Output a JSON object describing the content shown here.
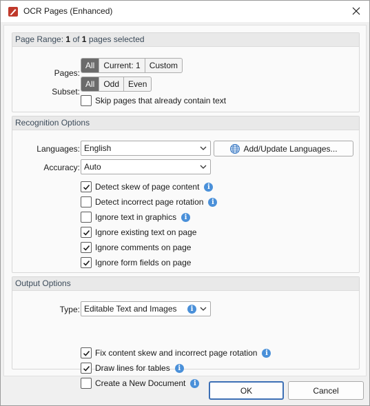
{
  "window": {
    "title": "OCR Pages (Enhanced)"
  },
  "page_range": {
    "header_prefix": "Page Range:",
    "selected_current": "1",
    "header_of": "of",
    "selected_total": "1",
    "header_suffix": "pages selected",
    "pages_label": "Pages:",
    "pages_options": [
      "All",
      "Current: 1",
      "Custom"
    ],
    "pages_selected": "All",
    "subset_label": "Subset:",
    "subset_options": [
      "All",
      "Odd",
      "Even"
    ],
    "subset_selected": "All",
    "skip_text": "Skip pages that already contain text",
    "skip_checked": false
  },
  "recognition": {
    "header": "Recognition Options",
    "languages_label": "Languages:",
    "languages_value": "English",
    "add_languages_button": "Add/Update Languages...",
    "accuracy_label": "Accuracy:",
    "accuracy_value": "Auto",
    "options": [
      {
        "label": "Detect skew of page content",
        "checked": true,
        "info": true
      },
      {
        "label": "Detect incorrect page rotation",
        "checked": false,
        "info": true
      },
      {
        "label": "Ignore text in graphics",
        "checked": false,
        "info": true
      },
      {
        "label": "Ignore existing text on page",
        "checked": true,
        "info": false
      },
      {
        "label": "Ignore comments on page",
        "checked": true,
        "info": false
      },
      {
        "label": "Ignore form fields on page",
        "checked": true,
        "info": false
      }
    ]
  },
  "output": {
    "header": "Output Options",
    "type_label": "Type:",
    "type_value": "Editable Text and Images",
    "options": [
      {
        "label": "Fix content skew and incorrect page rotation",
        "checked": true,
        "info": true
      },
      {
        "label": "Draw lines for tables",
        "checked": true,
        "info": true
      },
      {
        "label": "Create a New Document",
        "checked": false,
        "info": true
      }
    ]
  },
  "buttons": {
    "ok": "OK",
    "cancel": "Cancel"
  },
  "colors": {
    "accent": "#3c6fb5",
    "selected_segment": "#6b6b6b",
    "info": "#4a90d9",
    "app_icon": "#c0392b"
  }
}
